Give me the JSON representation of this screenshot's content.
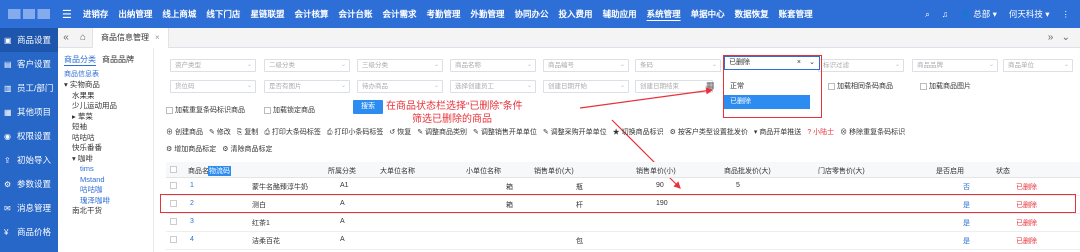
{
  "topnav": {
    "items": [
      "进销存",
      "出纳管理",
      "线上商城",
      "线下门店",
      "星链联盟",
      "会计核算",
      "会计台账",
      "会计需求",
      "考勤管理",
      "外勤管理",
      "协同办公",
      "投入费用",
      "辅助应用",
      "系统管理",
      "单据中心",
      "数据恢复",
      "账套管理"
    ],
    "active_index": 13
  },
  "topright": {
    "user": "总部",
    "company": "何天科技"
  },
  "sidebar": {
    "items": [
      "商品设置",
      "客户设置",
      "员工/部门",
      "其他项目",
      "权限设置",
      "初始导入",
      "参数设置",
      "消息管理",
      "商品价格"
    ],
    "active_index": 0
  },
  "tabs": {
    "current": "商品信息管理"
  },
  "tree": {
    "tabs": [
      "商品分类",
      "商品品牌"
    ],
    "title": "商品信息表",
    "nodes": [
      {
        "label": "实物商品",
        "indent": 0,
        "blue": false,
        "arrow": "▾"
      },
      {
        "label": "水果果",
        "indent": 1,
        "blue": false,
        "arrow": ""
      },
      {
        "label": "少儿运动用品",
        "indent": 1,
        "blue": false,
        "arrow": ""
      },
      {
        "label": "荤菜",
        "indent": 1,
        "blue": false,
        "arrow": "▸"
      },
      {
        "label": "短袖",
        "indent": 1,
        "blue": false,
        "arrow": ""
      },
      {
        "label": "咕咕咕",
        "indent": 1,
        "blue": false,
        "arrow": ""
      },
      {
        "label": "快乐番番",
        "indent": 1,
        "blue": false,
        "arrow": ""
      },
      {
        "label": "咖啡",
        "indent": 1,
        "blue": false,
        "arrow": "▾"
      },
      {
        "label": "tims",
        "indent": 2,
        "blue": true,
        "arrow": ""
      },
      {
        "label": "Mstand",
        "indent": 2,
        "blue": true,
        "arrow": ""
      },
      {
        "label": "咕咕咖",
        "indent": 2,
        "blue": true,
        "arrow": ""
      },
      {
        "label": "瑰泽咖啡",
        "indent": 2,
        "blue": true,
        "arrow": ""
      },
      {
        "label": "南北干货",
        "indent": 1,
        "blue": false,
        "arrow": ""
      }
    ]
  },
  "filters": {
    "row1": [
      "资产类型",
      "二级分类",
      "三级分类",
      "商品名称",
      "商品编号",
      "条码",
      "已删除",
      "标识过滤",
      "商品品牌",
      "商品单位"
    ],
    "row2": [
      "货位码",
      "是否有图片",
      "待办商品",
      "选择创建员工",
      "创建日期开始",
      "创建日期结束",
      "加载相同条码商品",
      "加载商品图片"
    ],
    "status_options": [
      "正常",
      "已删除"
    ],
    "selected_status": "已删除",
    "search_label": "搜索",
    "checkboxes": [
      "加载重复条码标识商品",
      "加载锁定商品"
    ]
  },
  "callout": {
    "line1": "在商品状态栏选择“已删除”条件",
    "line2": "筛选已删除的商品"
  },
  "toolbar": {
    "row1": [
      "创建商品",
      "修改",
      "复制",
      "打印大条码标签",
      "打印小条码标签",
      "恢复",
      "调整商品类别",
      "调整销售开单单位",
      "调整采购开单单位",
      "切换商品标识",
      "按客户类型设置批发价",
      "商品开单推送",
      "小陆士",
      "移除重复条码标识"
    ],
    "row2": [
      "增加商品标定",
      "清除商品标定"
    ]
  },
  "table": {
    "headers": [
      "#",
      "商品名称",
      "物流码",
      "所属分类",
      "大单位名称",
      "小单位名称",
      "销售单价(大)",
      "销售单价(小)",
      "商品批发价(大)",
      "门店零售价(大)",
      "是否启用",
      "状态"
    ],
    "rows": [
      {
        "idx": "1",
        "name": "蒙牛名酪臻淳牛奶",
        "code": "A1",
        "big_unit": "箱",
        "small_unit": "瓶",
        "price_big": "90",
        "price_small": "5",
        "enabled": "否",
        "status": "已删除"
      },
      {
        "idx": "2",
        "name": "测白",
        "code": "A",
        "big_unit": "箱",
        "small_unit": "杆",
        "price_big": "190",
        "price_small": "",
        "enabled": "是",
        "status": "已删除"
      },
      {
        "idx": "3",
        "name": "红茶1",
        "code": "A",
        "big_unit": "",
        "small_unit": "",
        "price_big": "",
        "price_small": "",
        "enabled": "是",
        "status": "已删除"
      },
      {
        "idx": "4",
        "name": "洁柔百花",
        "code": "A",
        "big_unit": "",
        "small_unit": "包",
        "price_big": "",
        "price_small": "",
        "enabled": "是",
        "status": "已删除"
      }
    ]
  },
  "colors": {
    "brand": "#2d6fd6",
    "highlight": "#e8323a",
    "selected": "#2d8cf0"
  }
}
